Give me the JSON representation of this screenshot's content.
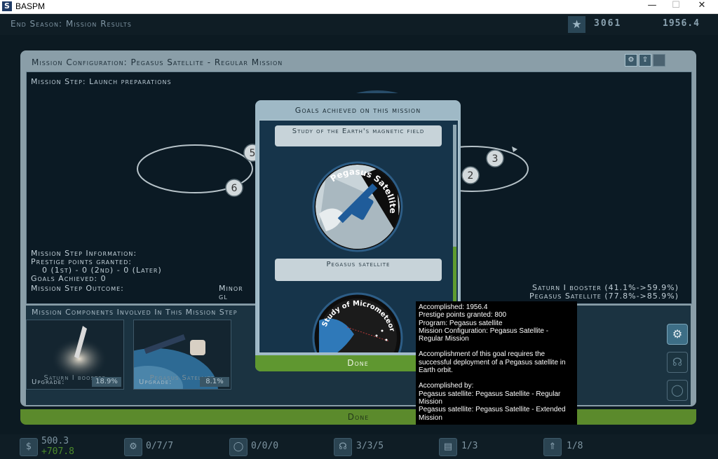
{
  "window": {
    "app_icon": "S",
    "title": "BASPM",
    "minimize": "—",
    "maximize": "☐",
    "close": "✕"
  },
  "topbar": {
    "season_label": "End Season: Mission Results",
    "prestige": "3061",
    "date": "1956.4",
    "star_icon": "star-icon"
  },
  "panel": {
    "title": "Mission Configuration: Pegasus Satellite - Regular Mission",
    "step_label": "Mission Step: Launch preparations",
    "orbit_steps": [
      "2",
      "3",
      "5",
      "6"
    ],
    "info": {
      "header": "Mission Step Information:",
      "prestige_label": "Prestige points granted:",
      "prestige_values": "0 (1st) - 0 (2nd) - 0 (Later)",
      "goals_label": "Goals Achieved: 0",
      "outcome_label": "Mission Step Outcome:",
      "outcome_value": "Minor gl"
    },
    "booster_lines": [
      "Saturn I booster (41.1%->59.9%)",
      "Pegasus Satellite (77.8%->85.9%)"
    ],
    "components_title": "Mission Components Involved In This Mission Step",
    "components": [
      {
        "name": "Saturn I booster",
        "upgrade_label": "Upgrade:",
        "upgrade_value": "18.9%"
      },
      {
        "name": "Pegasus Satellite",
        "upgrade_label": "Upgrade:",
        "upgrade_value": "8.1%"
      }
    ],
    "done_label": "Done"
  },
  "dialog": {
    "title": "Goals achieved on this mission",
    "goals": [
      {
        "title": "Study of the Earth's magnetic field",
        "badge_text": "Pegasus Satellite"
      },
      {
        "title": "Pegasus satellite",
        "badge_text": "Study of Micrometeoroids in"
      }
    ],
    "done_label": "Done"
  },
  "tooltip": {
    "accomplished": "Accomplished: 1956.4",
    "prestige": "Prestige points granted: 800",
    "program": "Program: Pegasus satellite",
    "config": "Mission Configuration: Pegasus Satellite - Regular Mission",
    "description": "Accomplishment of this goal requires the successful deployment of a Pegasus satellite in Earth orbit.",
    "by_label": "Accomplished by:",
    "by_1": "Pegasus satellite: Pegasus Satellite - Regular Mission",
    "by_2": "Pegasus satellite: Pegasus Satellite - Extended Mission"
  },
  "resources": {
    "money": "500.3",
    "money_delta": "+707.8",
    "money_icon": "dollar-icon",
    "items": [
      {
        "icon": "gear-icon",
        "value": "0/7/7"
      },
      {
        "icon": "capsule-icon",
        "value": "0/0/0"
      },
      {
        "icon": "headset-icon",
        "value": "3/3/5"
      },
      {
        "icon": "folder-icon",
        "value": "1/3"
      },
      {
        "icon": "rocket-icon",
        "value": "1/8"
      }
    ]
  },
  "colors": {
    "accent_green": "#5f9730",
    "panel": "#8a9ea8",
    "background": "#0c1a22"
  }
}
